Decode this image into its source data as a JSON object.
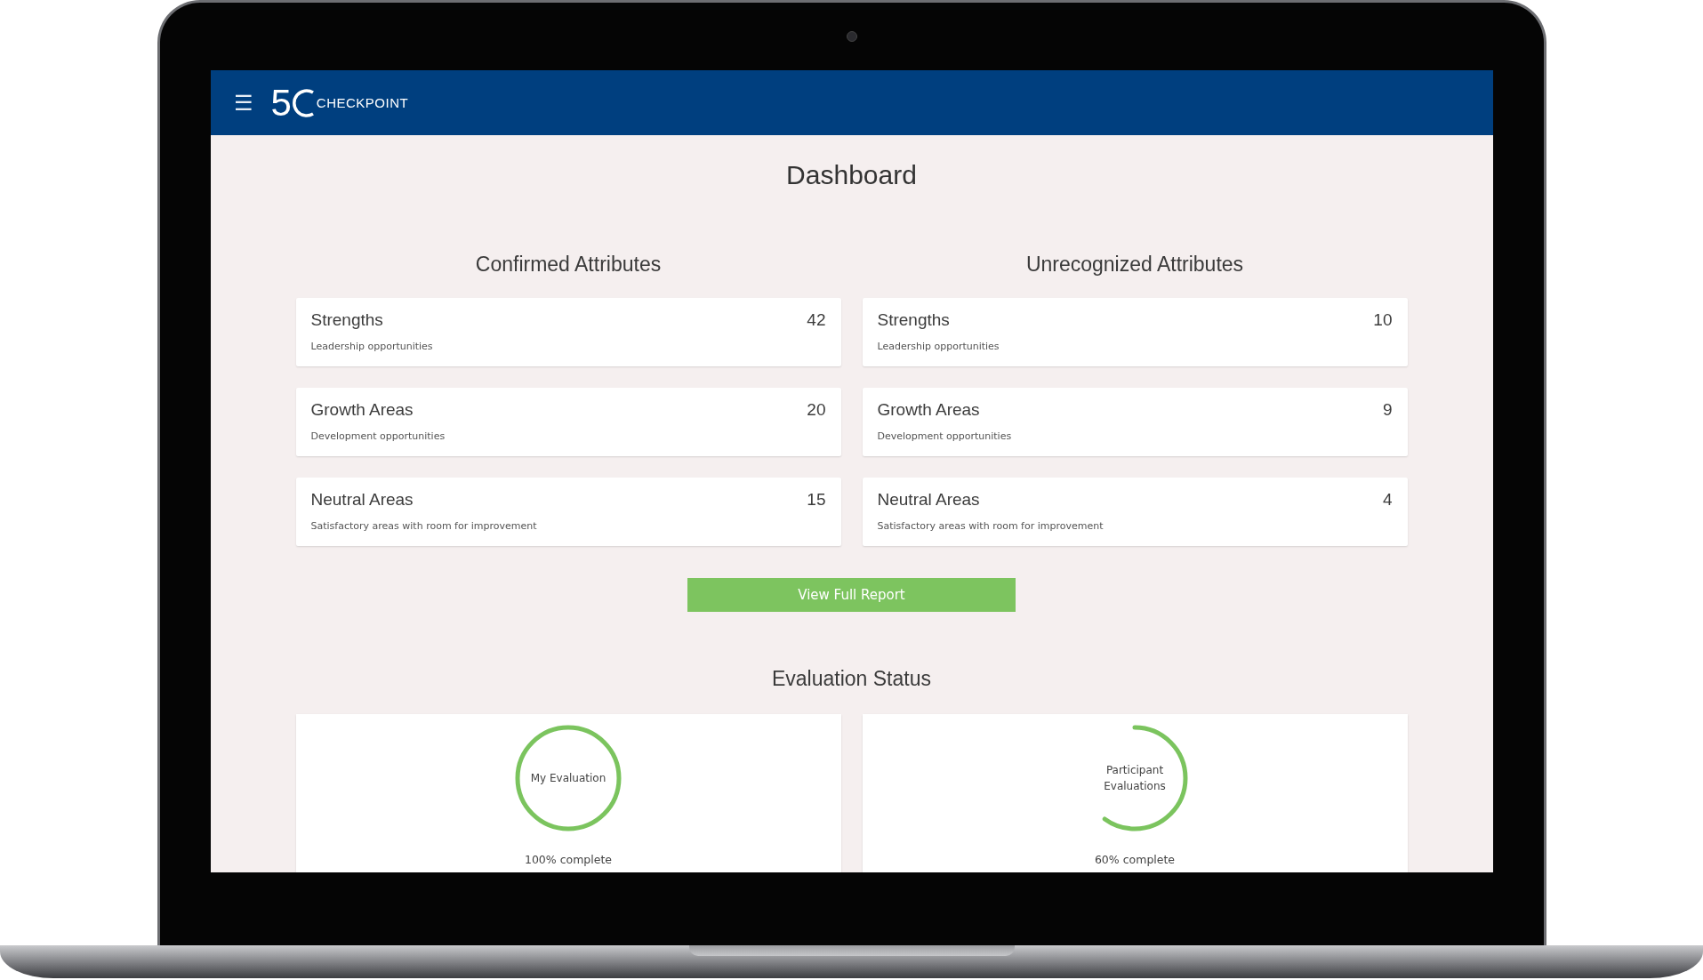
{
  "header": {
    "menu_icon": "☰",
    "logo": {
      "mark": "5",
      "name": "CHECKPOINT"
    }
  },
  "title": "Dashboard",
  "sections": [
    {
      "heading": "Confirmed Attributes",
      "cards": [
        {
          "title": "Strengths",
          "subtitle": "Leadership opportunities",
          "count": "42"
        },
        {
          "title": "Growth Areas",
          "subtitle": "Development opportunities",
          "count": "20"
        },
        {
          "title": "Neutral Areas",
          "subtitle": "Satisfactory areas with room for improvement",
          "count": "15"
        }
      ]
    },
    {
      "heading": "Unrecognized Attributes",
      "cards": [
        {
          "title": "Strengths",
          "subtitle": "Leadership opportunities",
          "count": "10"
        },
        {
          "title": "Growth Areas",
          "subtitle": "Development opportunities",
          "count": "9"
        },
        {
          "title": "Neutral Areas",
          "subtitle": "Satisfactory areas with room for improvement",
          "count": "4"
        }
      ]
    }
  ],
  "report_button": "View Full Report",
  "evaluation": {
    "heading": "Evaluation Status",
    "items": [
      {
        "label": "My Evaluation",
        "level": 1.0,
        "caption": "100% complete"
      },
      {
        "label": "Participant Evaluations",
        "level": 0.6,
        "caption": "60% complete"
      }
    ]
  }
}
